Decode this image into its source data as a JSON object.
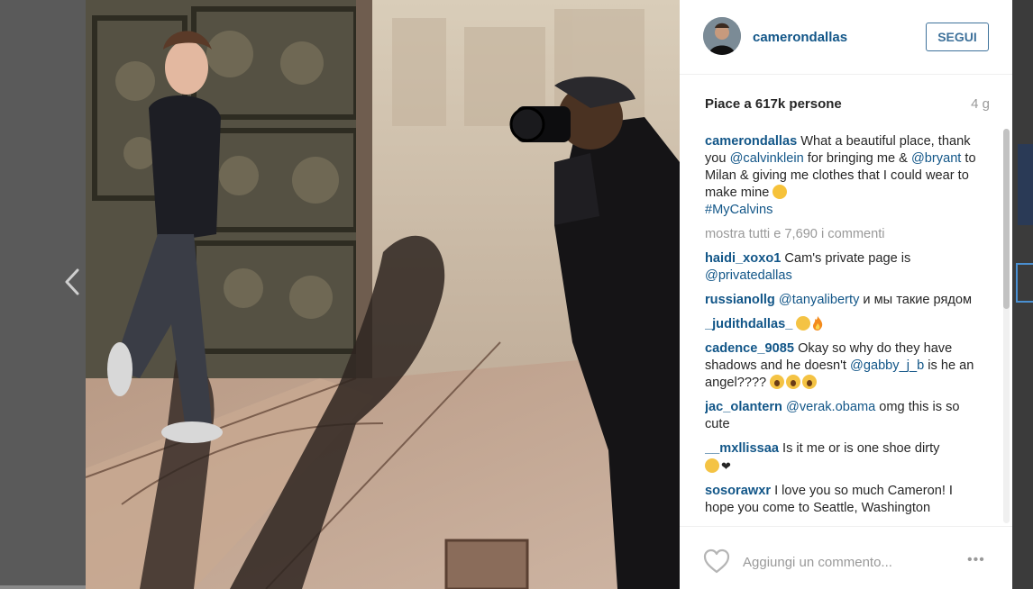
{
  "colors": {
    "accent": "#125688",
    "follow_border": "#3f729b",
    "muted": "#999999",
    "overlay": "#5a5a5a"
  },
  "navigation": {
    "prev_icon": "chevron-left-icon"
  },
  "post": {
    "image_alt": "Photo of a young man posing against an ornate bronze door while a photographer takes his picture",
    "author": {
      "username": "camerondallas",
      "follow_label": "SEGUI"
    },
    "likes_text": "Piace a 617k persone",
    "age": "4 g",
    "caption": {
      "username": "camerondallas",
      "parts": [
        {
          "text": "What a beautiful place, thank you ",
          "type": "text"
        },
        {
          "text": "@calvinklein",
          "type": "mention"
        },
        {
          "text": " for bringing me & ",
          "type": "text"
        },
        {
          "text": "@bryant",
          "type": "mention"
        },
        {
          "text": " to Milan & giving me clothes that I could wear to make mine ",
          "type": "text"
        },
        {
          "text": "#MyCalvins",
          "type": "mention"
        }
      ]
    },
    "show_all_comments": "mostra tutti e 7,690 i commenti",
    "comments": [
      {
        "username": "haidi_xoxo1",
        "text_before": "Cam's private page is ",
        "mention": "@privatedallas",
        "text_after": ""
      },
      {
        "username": "russianollg",
        "text_before": "",
        "mention": "@tanyaliberty",
        "text_after": " и мы такие рядом"
      },
      {
        "username": "_judithdallas_",
        "text_before": "",
        "mention": "",
        "text_after": ""
      },
      {
        "username": "cadence_9085",
        "text_before": "Okay so why do they have shadows and he doesn't ",
        "mention": "@gabby_j_b",
        "text_after": " is he an angel???? "
      },
      {
        "username": "jac_olantern",
        "text_before": "",
        "mention": "@verak.obama",
        "text_after": " omg this is so cute"
      },
      {
        "username": "__mxllissaa",
        "text_before": "Is it me or is one shoe dirty",
        "mention": "",
        "text_after": ""
      },
      {
        "username": "sosorawxr",
        "text_before": "I love you so much Cameron! I hope you come to Seattle, Washington",
        "mention": "",
        "text_after": ""
      }
    ],
    "footer": {
      "like_icon": "heart-outline-icon",
      "comment_placeholder": "Aggiungi un commento...",
      "more_label": "•••"
    }
  }
}
